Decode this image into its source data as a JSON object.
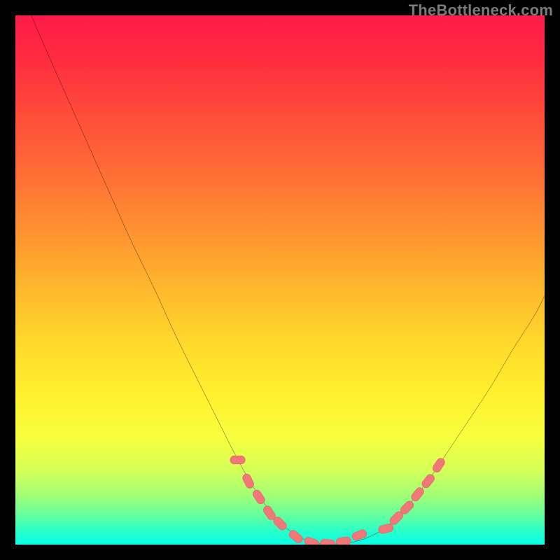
{
  "watermark": "TheBottleneck.com",
  "colors": {
    "frame": "#000000",
    "curve": "#000000",
    "marker_fill": "#f07878",
    "marker_stroke": "#e86a6a"
  },
  "chart_data": {
    "type": "line",
    "title": "",
    "xlabel": "",
    "ylabel": "",
    "xlim": [
      0,
      100
    ],
    "ylim": [
      0,
      100
    ],
    "series": [
      {
        "name": "curve",
        "x": [
          3,
          6,
          10,
          14,
          18,
          22,
          26,
          30,
          34,
          38,
          42,
          46,
          50,
          54,
          58,
          62,
          66,
          70,
          74,
          78,
          82,
          86,
          90,
          94,
          98,
          100
        ],
        "y": [
          100,
          93,
          84,
          75,
          66,
          57,
          49,
          40,
          32,
          24,
          16,
          9,
          4,
          1,
          0,
          0,
          1,
          3,
          7,
          12,
          18,
          24,
          30,
          37,
          43,
          47
        ]
      }
    ],
    "markers": [
      {
        "x": 42,
        "y": 16
      },
      {
        "x": 44,
        "y": 12
      },
      {
        "x": 46,
        "y": 9
      },
      {
        "x": 48,
        "y": 6
      },
      {
        "x": 50,
        "y": 4
      },
      {
        "x": 53,
        "y": 1.5
      },
      {
        "x": 56,
        "y": 0.4
      },
      {
        "x": 59,
        "y": 0.2
      },
      {
        "x": 62,
        "y": 0.6
      },
      {
        "x": 65,
        "y": 1.8
      },
      {
        "x": 70,
        "y": 3
      },
      {
        "x": 72,
        "y": 5
      },
      {
        "x": 74,
        "y": 7
      },
      {
        "x": 76,
        "y": 9.5
      },
      {
        "x": 78,
        "y": 12
      },
      {
        "x": 80,
        "y": 15
      }
    ]
  }
}
